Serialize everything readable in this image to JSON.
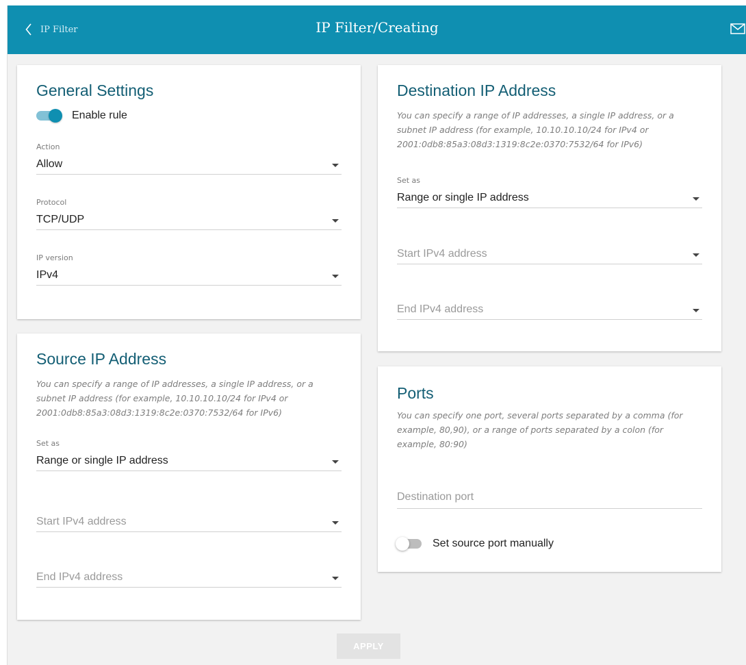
{
  "header": {
    "back_label": "IP Filter",
    "title": "IP Filter/Creating",
    "back_icon": "chevron-left-icon",
    "mail_icon": "envelope-icon"
  },
  "general": {
    "title": "General Settings",
    "enable_rule": {
      "label": "Enable rule",
      "on": true
    },
    "action": {
      "label": "Action",
      "value": "Allow"
    },
    "protocol": {
      "label": "Protocol",
      "value": "TCP/UDP"
    },
    "ip_version": {
      "label": "IP version",
      "value": "IPv4"
    }
  },
  "source": {
    "title": "Source IP Address",
    "description": "You can specify a range of IP addresses, a single IP address, or a subnet IP address (for example, 10.10.10.10/24 for IPv4 or 2001:0db8:85a3:08d3:1319:8c2e:0370:7532/64 for IPv6)",
    "set_as": {
      "label": "Set as",
      "value": "Range or single IP address"
    },
    "start_placeholder": "Start IPv4 address",
    "end_placeholder": "End IPv4 address"
  },
  "destination": {
    "title": "Destination IP Address",
    "description": "You can specify a range of IP addresses, a single IP address, or a subnet IP address (for example, 10.10.10.10/24 for IPv4 or 2001:0db8:85a3:08d3:1319:8c2e:0370:7532/64 for IPv6)",
    "set_as": {
      "label": "Set as",
      "value": "Range or single IP address"
    },
    "start_placeholder": "Start IPv4 address",
    "end_placeholder": "End IPv4 address"
  },
  "ports": {
    "title": "Ports",
    "description": "You can specify one port, several ports separated by a comma (for example, 80,90), or a range of ports separated by a colon (for example, 80:90)",
    "destination_port_placeholder": "Destination port",
    "source_port_toggle": {
      "label": "Set source port manually",
      "on": false
    }
  },
  "apply_label": "APPLY",
  "colors": {
    "header": "#0f8fb1",
    "card_title": "#135e74",
    "toggle_on": "#0f8fb1",
    "apply_disabled": "#e3e3e3"
  }
}
